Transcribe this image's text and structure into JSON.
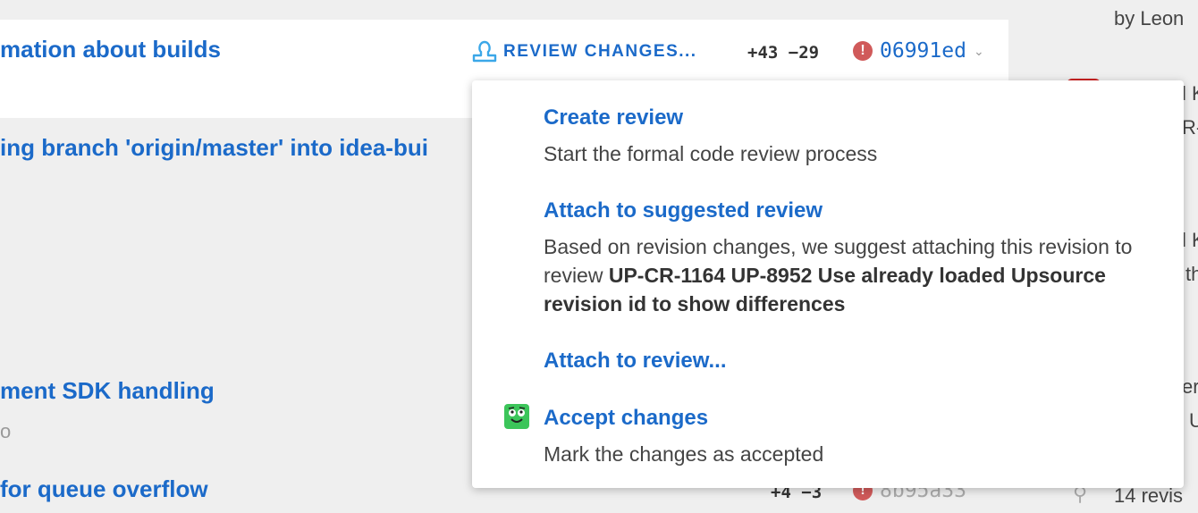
{
  "rows": [
    {
      "title": "mation about builds",
      "subtitle": ""
    },
    {
      "title": "ing branch 'origin/master' into idea-bui",
      "subtitle": ""
    },
    {
      "title": "ment SDK handling",
      "subtitle": "o"
    },
    {
      "title": "for queue overflow",
      "subtitle": ""
    }
  ],
  "active_row": {
    "review_button_label": "REVIEW CHANGES...",
    "additions": "+43",
    "deletions": "−29",
    "revision_hash": "06991ed",
    "status_icon": "error-icon"
  },
  "last_row": {
    "additions": "+4",
    "deletions": "−3",
    "revision_hash": "8b95a33"
  },
  "right_panel": {
    "author": "by Leon",
    "snippets": [
      "l K",
      "R-",
      "l K",
      "th",
      "er",
      "U"
    ],
    "revisions_count": "14 revis"
  },
  "menu": {
    "items": [
      {
        "title": "Create review",
        "description": "Start the formal code review process"
      },
      {
        "title": "Attach to suggested review",
        "description_prefix": "Based on revision changes, we suggest attaching this revision to review ",
        "description_bold": "UP-CR-1164 UP-8952 Use already loaded Upsource revision id to show differences"
      },
      {
        "title": "Attach to review...",
        "description": ""
      },
      {
        "title": "Accept changes",
        "description": "Mark the changes as accepted",
        "icon": "smiley-icon"
      }
    ]
  }
}
